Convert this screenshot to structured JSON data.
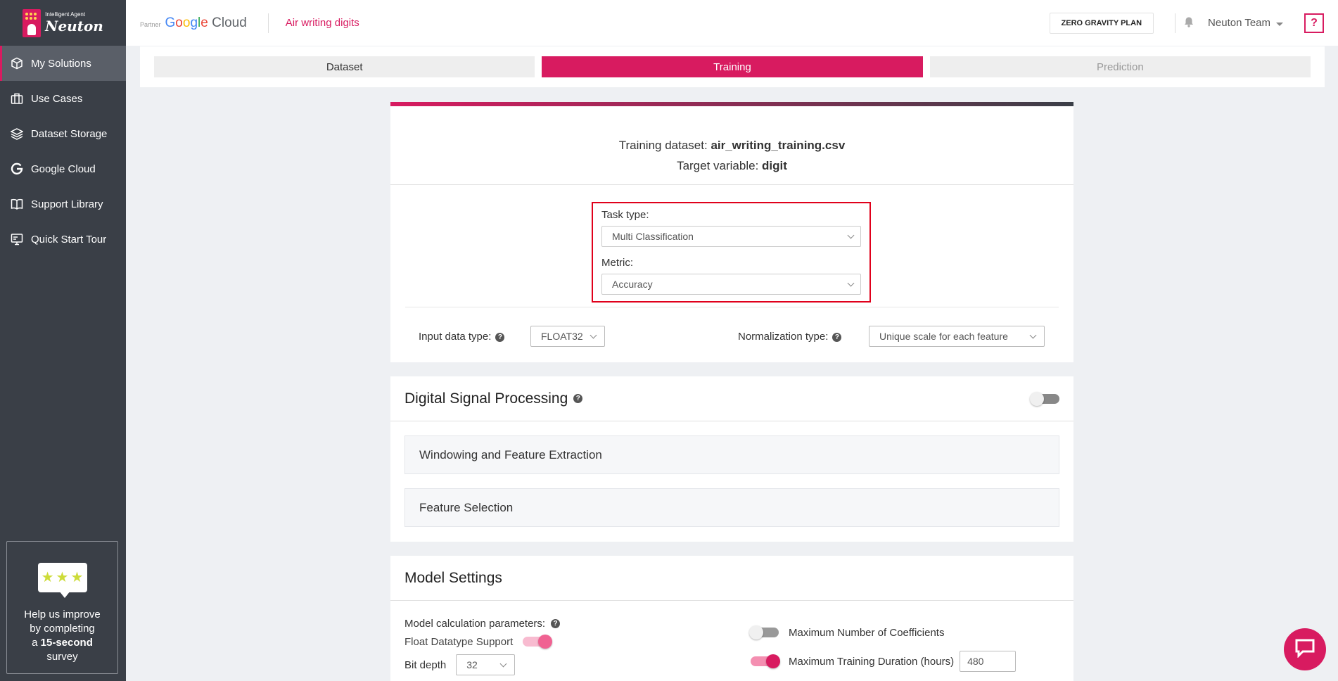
{
  "brand": {
    "tagline": "Intelligent Agent",
    "name": "Neuton"
  },
  "sidebar": {
    "items": [
      {
        "label": "My Solutions",
        "icon": "cube-icon"
      },
      {
        "label": "Use Cases",
        "icon": "briefcase-icon"
      },
      {
        "label": "Dataset Storage",
        "icon": "layers-icon"
      },
      {
        "label": "Google Cloud",
        "icon": "google-g-icon"
      },
      {
        "label": "Support Library",
        "icon": "book-icon"
      },
      {
        "label": "Quick Start Tour",
        "icon": "monitor-icon"
      }
    ],
    "survey": {
      "line1": "Help us improve",
      "line2": "by completing",
      "line3_pre": "a",
      "line3_bold": "15-second",
      "line4": "survey"
    }
  },
  "topbar": {
    "partner_label": "Partner",
    "partner_name": "Google Cloud",
    "solution_title": "Air writing digits",
    "plan_button": "ZERO GRAVITY PLAN",
    "team": "Neuton Team",
    "help": "?"
  },
  "tabs": [
    {
      "label": "Dataset",
      "state": "normal"
    },
    {
      "label": "Training",
      "state": "active"
    },
    {
      "label": "Prediction",
      "state": "disabled"
    }
  ],
  "training": {
    "dataset_label": "Training dataset:",
    "dataset_value": "air_writing_training.csv",
    "target_label": "Target variable:",
    "target_value": "digit",
    "task_type_label": "Task type:",
    "task_type_value": "Multi Classification",
    "metric_label": "Metric:",
    "metric_value": "Accuracy",
    "input_type_label": "Input data type:",
    "input_type_value": "FLOAT32",
    "normalization_label": "Normalization type:",
    "normalization_value": "Unique scale for each feature"
  },
  "dsp": {
    "title": "Digital Signal Processing",
    "enabled": false,
    "sections": [
      "Windowing and Feature Extraction",
      "Feature Selection"
    ]
  },
  "model_settings": {
    "title": "Model Settings",
    "params_label": "Model calculation parameters:",
    "float_support_label": "Float Datatype Support",
    "float_support_enabled": true,
    "bit_depth_label": "Bit depth",
    "bit_depth_value": "32",
    "max_coeff_label": "Maximum Number of Coefficients",
    "max_coeff_enabled": false,
    "max_duration_label": "Maximum Training Duration (hours)",
    "max_duration_enabled": true,
    "max_duration_value": "480"
  },
  "colors": {
    "accent": "#d81b60",
    "sidebar": "#3a3f47",
    "highlight_box": "#e0001b"
  }
}
